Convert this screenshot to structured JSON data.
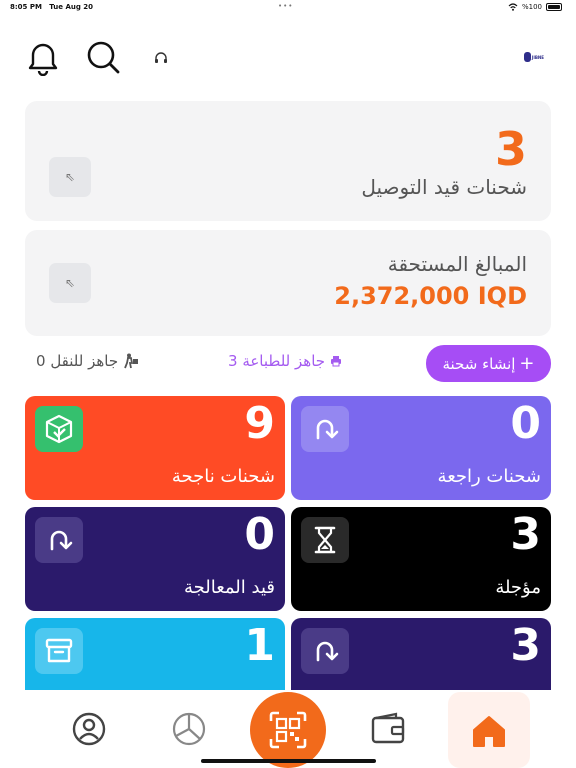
{
  "status_bar": {
    "time": "8:05 PM",
    "date": "Tue Aug 20",
    "battery": "%100"
  },
  "header": {
    "icons": [
      "bell-icon",
      "search-icon",
      "headset-icon"
    ],
    "logo_text": "JIBNE"
  },
  "delivery_card": {
    "count": "3",
    "label": "شحنات قيد التوصيل"
  },
  "dues_card": {
    "label": "المبالغ المستحقة",
    "amount": "2,372,000 IQD"
  },
  "actions": {
    "create_label": "إنشاء شحنة",
    "create_icon": "+",
    "ready_print": "جاهز للطباعة 3",
    "ready_move": "جاهز للنقل 0"
  },
  "tiles": [
    {
      "count": "9",
      "label": "شحنات ناجحة",
      "color": "#ff4b25",
      "icon_bg": "#35c06e",
      "icon": "box-check-icon"
    },
    {
      "count": "0",
      "label": "شحنات راجعة",
      "color": "#7b68ee",
      "icon_bg": "#9487f1",
      "icon": "return-arrow-icon"
    },
    {
      "count": "0",
      "label": "قيد المعالجة",
      "color": "#2b1a6b",
      "icon_bg": "#4a3b87",
      "icon": "return-arrow-icon"
    },
    {
      "count": "3",
      "label": "مؤجلة",
      "color": "#000000",
      "icon_bg": "#2a2a2a",
      "icon": "hourglass-icon"
    },
    {
      "count": "1",
      "label": "",
      "color": "#17b6ea",
      "icon_bg": "#4dc8f0",
      "icon": "archive-icon"
    },
    {
      "count": "3",
      "label": "",
      "color": "#2b1a6b",
      "icon_bg": "#4a3b87",
      "icon": "return-arrow-icon"
    }
  ],
  "colors": {
    "accent": "#f26a1b",
    "purple": "#a64df5"
  },
  "bottom_nav": [
    "profile-icon",
    "chart-icon",
    "qr-scan-icon",
    "wallet-icon",
    "home-icon"
  ]
}
